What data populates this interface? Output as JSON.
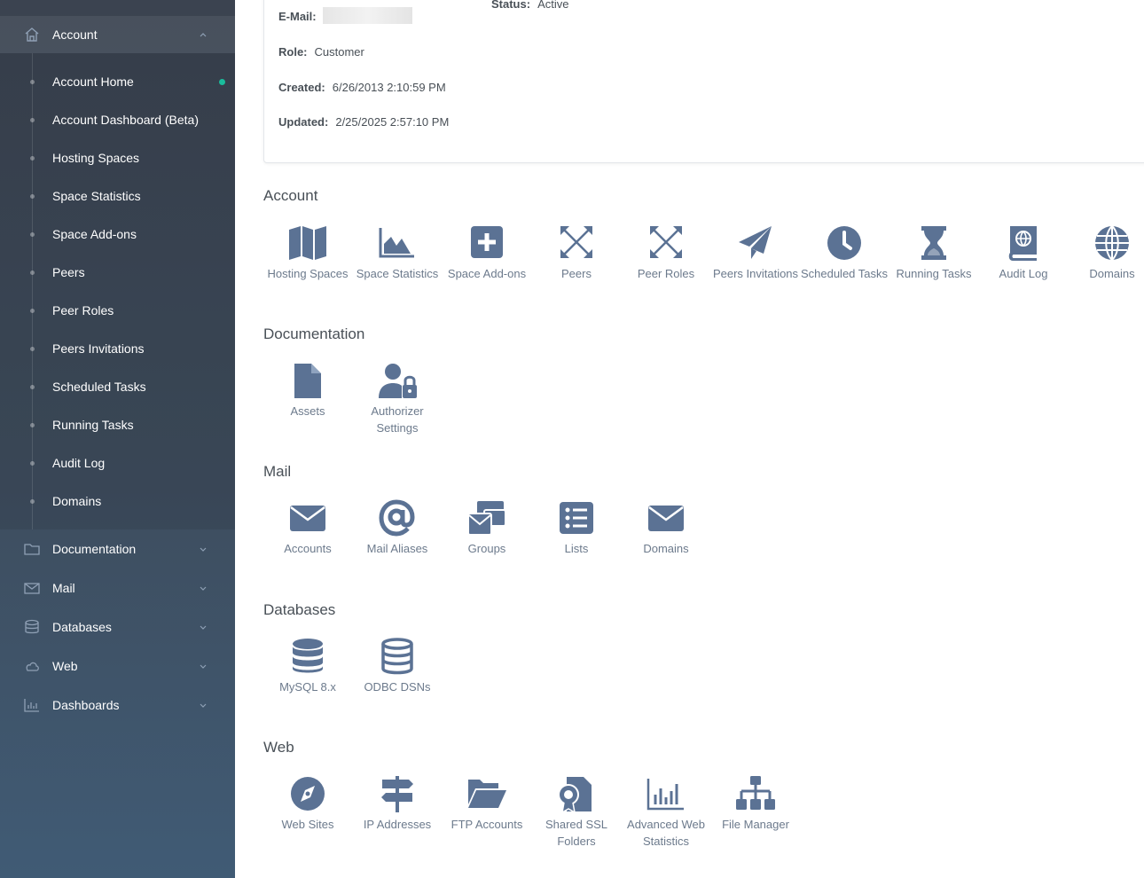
{
  "sidebar": {
    "header": {
      "label": "Account"
    },
    "sub_items": [
      {
        "label": "Account Home",
        "active": true
      },
      {
        "label": "Account Dashboard (Beta)"
      },
      {
        "label": "Hosting Spaces"
      },
      {
        "label": "Space Statistics"
      },
      {
        "label": "Space Add-ons"
      },
      {
        "label": "Peers"
      },
      {
        "label": "Peer Roles"
      },
      {
        "label": "Peers Invitations"
      },
      {
        "label": "Scheduled Tasks"
      },
      {
        "label": "Running Tasks"
      },
      {
        "label": "Audit Log"
      },
      {
        "label": "Domains"
      }
    ],
    "menu": [
      {
        "label": "Documentation",
        "icon": "folder-icon"
      },
      {
        "label": "Mail",
        "icon": "envelope-icon"
      },
      {
        "label": "Databases",
        "icon": "database-icon"
      },
      {
        "label": "Web",
        "icon": "cloud-icon"
      },
      {
        "label": "Dashboards",
        "icon": "bar-chart-icon"
      }
    ]
  },
  "account_info": {
    "status_label": "Status:",
    "status_value": "Active",
    "email_label": "E-Mail:",
    "role_label": "Role:",
    "role_value": "Customer",
    "created_label": "Created:",
    "created_value": "6/26/2013 2:10:59 PM",
    "updated_label": "Updated:",
    "updated_value": "2/25/2025 2:57:10 PM"
  },
  "sections": {
    "account": {
      "title": "Account",
      "tiles": [
        "Hosting Spaces",
        "Space Statistics",
        "Space Add-ons",
        "Peers",
        "Peer Roles",
        "Peers Invitations",
        "Scheduled Tasks",
        "Running Tasks",
        "Audit Log",
        "Domains"
      ]
    },
    "documentation": {
      "title": "Documentation",
      "tiles": [
        "Assets",
        "Authorizer Settings"
      ]
    },
    "mail": {
      "title": "Mail",
      "tiles": [
        "Accounts",
        "Mail Aliases",
        "Groups",
        "Lists",
        "Domains"
      ]
    },
    "databases": {
      "title": "Databases",
      "tiles": [
        "MySQL 8.x",
        "ODBC DSNs"
      ]
    },
    "web": {
      "title": "Web",
      "tiles": [
        "Web Sites",
        "IP Addresses",
        "FTP Accounts",
        "Shared SSL Folders",
        "Advanced Web Statistics",
        "File Manager"
      ]
    }
  },
  "colors": {
    "icon": "#5b7294",
    "active_dot": "#1abc9c"
  }
}
